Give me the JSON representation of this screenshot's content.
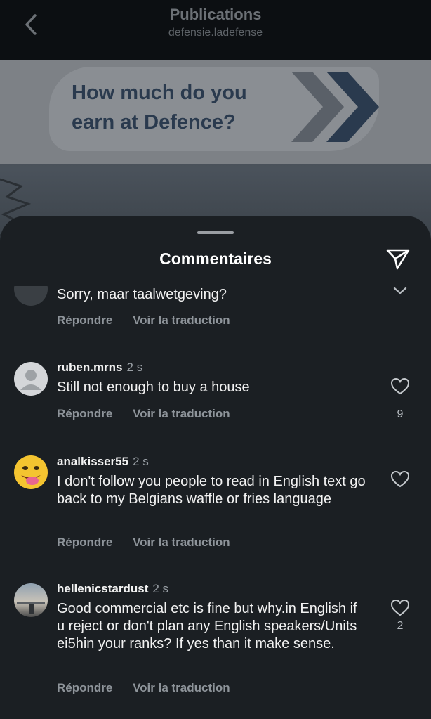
{
  "header": {
    "title": "Publications",
    "subtitle": "defensie.ladefense"
  },
  "post": {
    "banner_text_line1": "How much do you",
    "banner_text_line2": "earn at Defence?"
  },
  "sheet": {
    "title": "Commentaires"
  },
  "comments": [
    {
      "user": "",
      "time": "",
      "text": "Sorry, maar taalwetgeving?",
      "reply": "Répondre",
      "translate": "Voir la traduction",
      "likes": ""
    },
    {
      "user": "ruben.mrns",
      "time": "2 s",
      "text": "Still not enough to buy a house",
      "reply": "Répondre",
      "translate": "Voir la traduction",
      "likes": "9"
    },
    {
      "user": "analkisser55",
      "time": "2 s",
      "text": "I don't follow you people to read in English text go back to my Belgians waffle or fries language",
      "reply": "Répondre",
      "translate": "Voir la traduction",
      "likes": ""
    },
    {
      "user": "hellenicstardust",
      "time": "2 s",
      "text": "Good commercial etc is fine but why.in English if u reject or don't plan any English speakers/Units ei5hin your ranks? If yes than it make sense.",
      "reply": "Répondre",
      "translate": "Voir la traduction",
      "likes": "2"
    }
  ],
  "colors": {
    "background": "#1b1f23",
    "topbar": "#0c0f12",
    "muted": "#8e949a"
  }
}
